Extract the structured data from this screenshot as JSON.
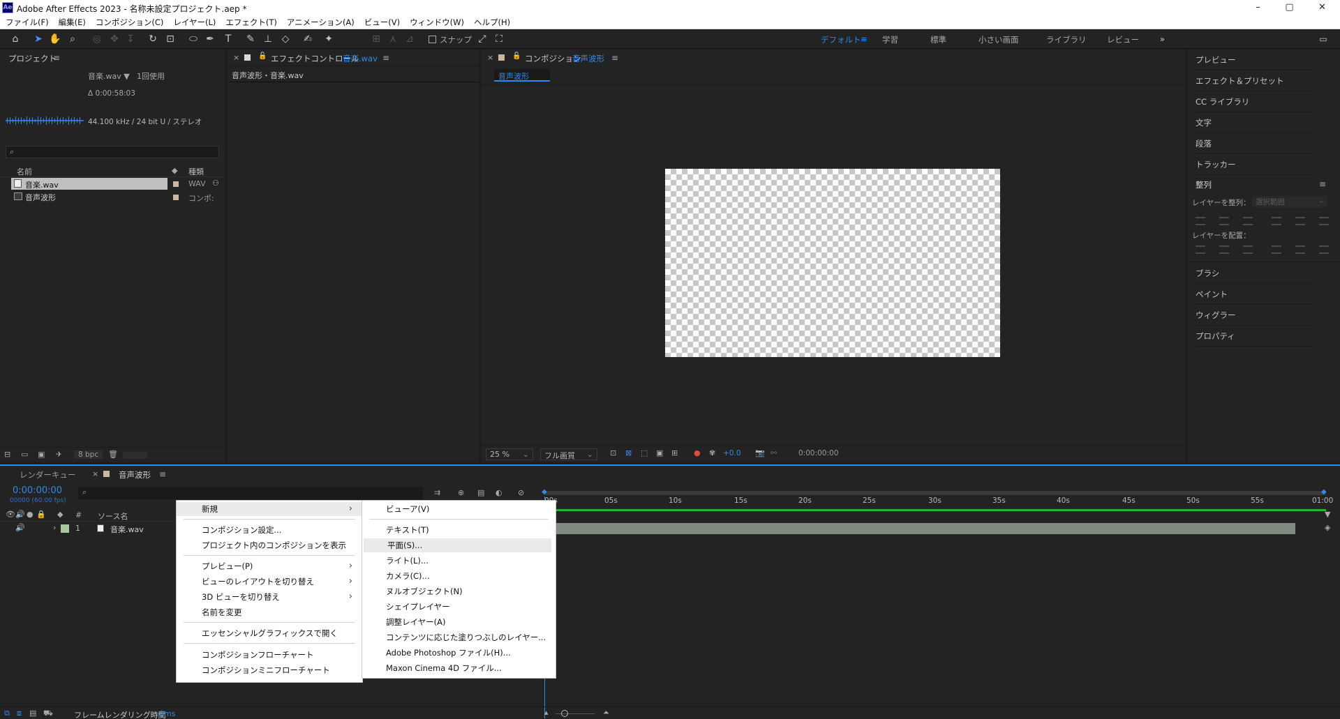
{
  "app": {
    "icon_label": "Ae",
    "title": "Adobe After Effects 2023 - 名称未設定プロジェクト.aep *",
    "window_controls": {
      "minimize": "–",
      "maximize": "▢",
      "close": "✕"
    }
  },
  "menubar": [
    "ファイル(F)",
    "編集(E)",
    "コンポジション(C)",
    "レイヤー(L)",
    "エフェクト(T)",
    "アニメーション(A)",
    "ビュー(V)",
    "ウィンドウ(W)",
    "ヘルプ(H)"
  ],
  "toolbar": {
    "snap_label": "スナップ",
    "workspaces": [
      "デフォルト",
      "学習",
      "標準",
      "小さい画面",
      "ライブラリ",
      "レビュー"
    ],
    "active_workspace": "デフォルト",
    "more": "»"
  },
  "project_panel": {
    "title": "プロジェクト",
    "selected_name": "音楽.wav ▼",
    "usage": "1回使用",
    "duration": "Δ 0:00:58:03",
    "audio_info": "44.100 kHz / 24 bit U / ステレオ",
    "search_icon": "⌕",
    "col_name": "名前",
    "col_type": "種類",
    "items": [
      {
        "name": "音楽.wav",
        "type": "WAV",
        "selected": true
      },
      {
        "name": "音声波形",
        "type": "コンポ:",
        "selected": false
      }
    ],
    "bpc": "8 bpc"
  },
  "effect_panel": {
    "title_prefix": "エフェクトコントロール",
    "title_file": "音楽.wav",
    "subtitle": "音声波形・音楽.wav"
  },
  "comp_panel": {
    "title_prefix": "コンポジション",
    "title_comp": "音声波形",
    "breadcrumb": "音声波形",
    "zoom": "25 %",
    "quality": "フル画質",
    "exposure": "+0.0",
    "timecode": "0:00:00:00"
  },
  "right_panels": [
    "プレビュー",
    "エフェクト＆プリセット",
    "CC ライブラリ",
    "文字",
    "段落",
    "トラッカー"
  ],
  "align_panel": {
    "title": "整列",
    "align_to_label": "レイヤーを整列：",
    "align_to_value": "選択範囲",
    "distribute_label": "レイヤーを配置："
  },
  "right_panels_bottom": [
    "ブラシ",
    "ペイント",
    "ウィグラー",
    "プロパティ"
  ],
  "timeline": {
    "tab_render": "レンダーキュー",
    "tab_comp": "音声波形",
    "timecode": "0:00:00:00",
    "fps": "00000 (60.00 fps)",
    "col_number": "#",
    "col_source": "ソース名",
    "layer_number": "1",
    "layer_name": "音楽.wav",
    "ruler": [
      "00s",
      "05s",
      "10s",
      "15s",
      "20s",
      "25s",
      "30s",
      "35s",
      "40s",
      "45s",
      "50s",
      "55s",
      "01:00"
    ],
    "frame_render_label": "フレームレンダリング時間",
    "frame_render_value": "0ms"
  },
  "context_menu": {
    "items": [
      {
        "label": "新規",
        "submenu": true,
        "highlight": true
      },
      {
        "sep": true
      },
      {
        "label": "コンポジション設定..."
      },
      {
        "label": "プロジェクト内のコンポジションを表示"
      },
      {
        "sep": true
      },
      {
        "label": "プレビュー(P)",
        "submenu": true
      },
      {
        "label": "ビューのレイアウトを切り替え",
        "submenu": true
      },
      {
        "label": "3D ビューを切り替え",
        "submenu": true
      },
      {
        "label": "名前を変更"
      },
      {
        "sep": true
      },
      {
        "label": "エッセンシャルグラフィックスで開く"
      },
      {
        "sep": true
      },
      {
        "label": "コンポジションフローチャート"
      },
      {
        "label": "コンポジションミニフローチャート"
      }
    ],
    "submenu": [
      {
        "label": "ビューア(V)"
      },
      {
        "sep": true
      },
      {
        "label": "テキスト(T)"
      },
      {
        "label": "平面(S)...",
        "highlight": true
      },
      {
        "label": "ライト(L)..."
      },
      {
        "label": "カメラ(C)..."
      },
      {
        "label": "ヌルオブジェクト(N)"
      },
      {
        "label": "シェイプレイヤー"
      },
      {
        "label": "調整レイヤー(A)"
      },
      {
        "label": "コンテンツに応じた塗りつぶしのレイヤー..."
      },
      {
        "label": "Adobe Photoshop ファイル(H)..."
      },
      {
        "label": "Maxon Cinema 4D ファイル..."
      }
    ]
  },
  "colors": {
    "accent": "#2d8ceb",
    "panel": "#232323",
    "background": "#1d1d1d",
    "track": "#7f8c80",
    "timeline_green": "#1fb834"
  }
}
